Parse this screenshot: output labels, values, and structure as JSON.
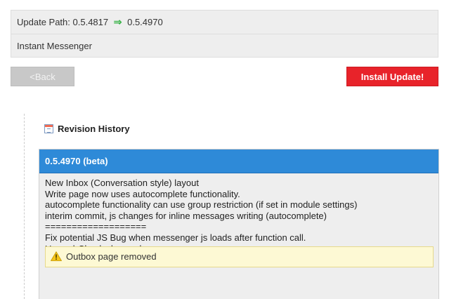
{
  "header": {
    "update_label": "Update Path:",
    "from_version": "0.5.4817",
    "arrow_glyph": "⇒",
    "to_version": "0.5.4970",
    "module_name": "Instant Messenger"
  },
  "actions": {
    "back_label": "<Back",
    "install_label": "Install Update!"
  },
  "revision": {
    "section_title": "Revision History",
    "version_label": "0.5.4970 (beta)",
    "notes": [
      "New Inbox (Conversation style) layout",
      "Write page now uses autocomplete functionality.",
      "autocomplete functionality can use group restriction (if set in module settings)",
      "interim commit, js changes for inline messages writing (autocomplete)",
      "===================",
      "Fix potential JS Bug when messenger js loads after function call.",
      "Unread-Check changed"
    ],
    "warning_text": "Outbox page removed"
  },
  "colors": {
    "accent_blue": "#2e8ad8",
    "install_red": "#e8232a",
    "arrow_green": "#3cb44b",
    "warning_bg": "#fdf9d4"
  }
}
